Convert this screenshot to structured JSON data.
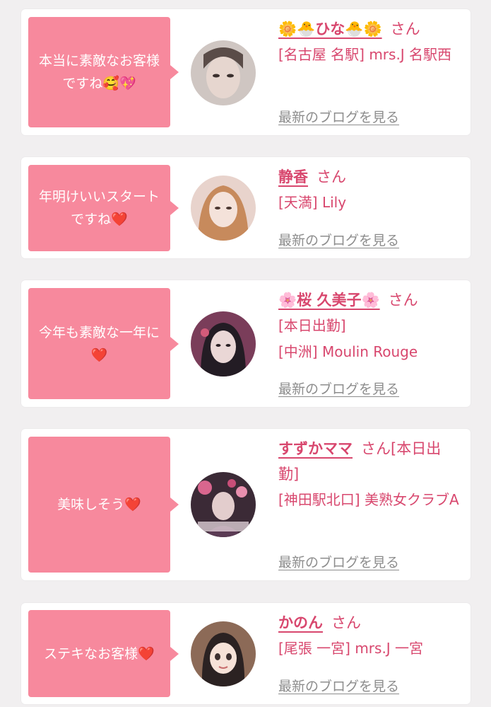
{
  "cards": [
    {
      "message": "本当に素敵なお客様ですね🥰💖",
      "name": "🌼🐣ひな🐣🌼",
      "honorific": "さん",
      "shop": "[名古屋 名駅] mrs.J 名駅西",
      "blog_link": "最新のブログを見る"
    },
    {
      "message": "年明けいいスタートですね❤️",
      "name": "静香",
      "honorific": "さん",
      "shop": "[天満] Lily",
      "blog_link": "最新のブログを見る"
    },
    {
      "message": "今年も素敵な一年に❤️",
      "name": "🌸桜 久美子🌸",
      "honorific": "さん",
      "shop": "[本日出勤]\n[中洲] Moulin Rouge",
      "blog_link": "最新のブログを見る"
    },
    {
      "message": "美味しそう❤️",
      "name": "すずかママ",
      "honorific": "さん[本日出勤]",
      "shop": "[神田駅北口] 美熟女クラブA",
      "blog_link": "最新のブログを見る"
    },
    {
      "message": "ステキなお客様❤️",
      "name": "かのん",
      "honorific": "さん",
      "shop": "[尾張 一宮] mrs.J 一宮",
      "blog_link": "最新のブログを見る"
    }
  ]
}
